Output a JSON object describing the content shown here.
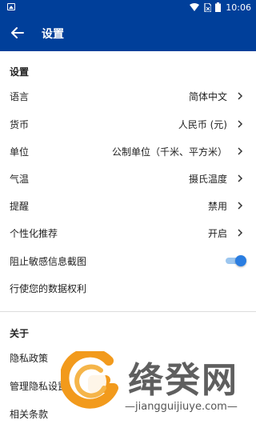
{
  "status_bar": {
    "time": "10:06"
  },
  "app_bar": {
    "title": "设置"
  },
  "settings_section": {
    "title": "设置",
    "rows": [
      {
        "label": "语言",
        "value": "简体中文"
      },
      {
        "label": "货币",
        "value": "人民币 (元)"
      },
      {
        "label": "单位",
        "value": "公制单位（千米、平方米）"
      },
      {
        "label": "气温",
        "value": "摄氏温度"
      },
      {
        "label": "提醒",
        "value": "禁用"
      },
      {
        "label": "个性化推荐",
        "value": "开启"
      }
    ],
    "screenshot_block": {
      "label": "阻止敏感信息截图",
      "enabled": true
    },
    "data_rights": {
      "label": "行使您的数据权利"
    }
  },
  "about_section": {
    "title": "关于",
    "rows": [
      {
        "label": "隐私政策"
      },
      {
        "label": "管理隐私设置"
      },
      {
        "label": "相关条款"
      }
    ]
  },
  "watermark": {
    "brand": "绛癸网",
    "url": "—jiangguijiuye.com—"
  },
  "colors": {
    "app_bar": "#003f9a",
    "toggle_on": "#2a7de1",
    "watermark_orange": "#f29a1c"
  }
}
